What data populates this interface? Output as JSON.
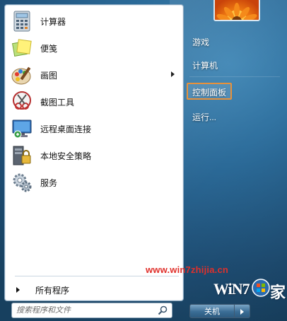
{
  "programs": [
    {
      "label": "计算器",
      "icon": "calculator-icon"
    },
    {
      "label": "便笺",
      "icon": "sticky-notes-icon"
    },
    {
      "label": "画图",
      "icon": "paint-icon"
    },
    {
      "label": "截图工具",
      "icon": "snipping-tool-icon"
    },
    {
      "label": "远程桌面连接",
      "icon": "remote-desktop-icon"
    },
    {
      "label": "本地安全策略",
      "icon": "local-security-policy-icon"
    },
    {
      "label": "服务",
      "icon": "services-icon"
    }
  ],
  "all_programs": {
    "label": "所有程序"
  },
  "search": {
    "placeholder": "搜索程序和文件"
  },
  "right_links": [
    {
      "label": "游戏"
    },
    {
      "label": "计算机"
    },
    {
      "label": "控制面板"
    },
    {
      "label": "运行..."
    }
  ],
  "shutdown": {
    "label": "关机"
  },
  "watermark": {
    "url": "www.win7zhijia.cn",
    "logo_text": "WiN7",
    "logo_suffix": "家"
  },
  "colors": {
    "highlight": "#e8913a",
    "watermark_red": "#e0302b"
  }
}
